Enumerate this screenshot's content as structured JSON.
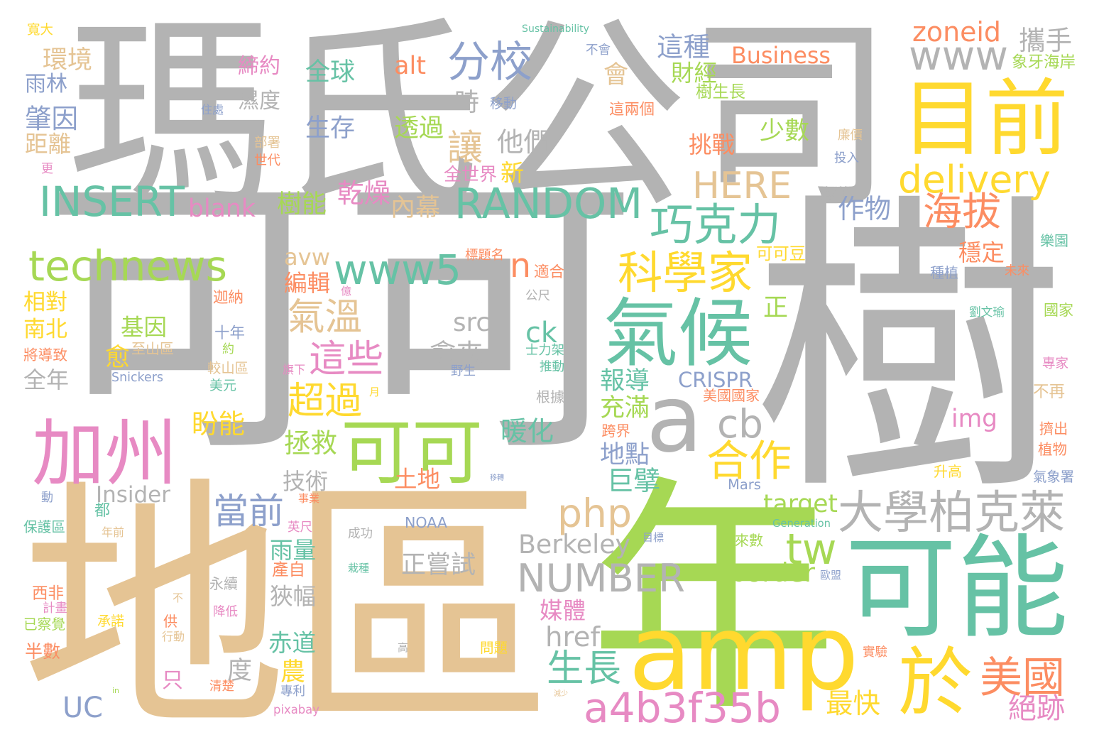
{
  "palette": {
    "gray": "#b3b3b3",
    "tan": "#e5c494",
    "green": "#a6d854",
    "yellow": "#ffd92f",
    "teal": "#66c2a5",
    "orange": "#fc8d62",
    "blue": "#8da0cb",
    "pink": "#e78ac3"
  },
  "words": [
    {
      "text": "瑪氏公司",
      "color": "#b3b3b3"
    },
    {
      "text": "可可",
      "color": "#b3b3b3"
    },
    {
      "text": "樹",
      "color": "#b3b3b3"
    },
    {
      "text": "地區",
      "color": "#e5c494"
    },
    {
      "text": "年",
      "color": "#a6d854"
    },
    {
      "text": "amp",
      "color": "#ffd92f"
    },
    {
      "text": "可能",
      "color": "#66c2a5"
    },
    {
      "text": "目前",
      "color": "#ffd92f"
    },
    {
      "text": "氣候",
      "color": "#66c2a5"
    },
    {
      "text": "加州",
      "color": "#e78ac3"
    },
    {
      "text": "a",
      "color": "#b3b3b3"
    },
    {
      "text": "大學柏克萊",
      "color": "#b3b3b3"
    },
    {
      "text": "於",
      "color": "#ffd92f"
    },
    {
      "text": "美國",
      "color": "#fc8d62"
    },
    {
      "text": "delivery",
      "color": "#ffd92f"
    },
    {
      "text": "海拔",
      "color": "#fc8d62"
    },
    {
      "text": "巧克力",
      "color": "#66c2a5"
    },
    {
      "text": "科學家",
      "color": "#ffd92f"
    },
    {
      "text": "RANDOM",
      "color": "#66c2a5"
    },
    {
      "text": "INSERT",
      "color": "#66c2a5"
    },
    {
      "text": "blank",
      "color": "#e78ac3"
    },
    {
      "text": "technews",
      "color": "#a6d854"
    },
    {
      "text": "www5",
      "color": "#66c2a5"
    },
    {
      "text": "n",
      "color": "#fc8d62"
    },
    {
      "text": "分校",
      "color": "#8da0cb"
    },
    {
      "text": "www",
      "color": "#b3b3b3"
    },
    {
      "text": "zoneid",
      "color": "#fc8d62"
    },
    {
      "text": "攜手",
      "color": "#b3b3b3"
    },
    {
      "text": "Business",
      "color": "#fc8d62"
    },
    {
      "text": "這種",
      "color": "#8da0cb"
    },
    {
      "text": "財經",
      "color": "#a6d854"
    },
    {
      "text": "會",
      "color": "#e5c494"
    },
    {
      "text": "樹生長",
      "color": "#a6d854"
    },
    {
      "text": "象牙海岸",
      "color": "#a6d854"
    },
    {
      "text": "alt",
      "color": "#fc8d62"
    },
    {
      "text": "全球",
      "color": "#66c2a5"
    },
    {
      "text": "締約",
      "color": "#e78ac3"
    },
    {
      "text": "環境",
      "color": "#e5c494"
    },
    {
      "text": "雨林",
      "color": "#8da0cb"
    },
    {
      "text": "濕度",
      "color": "#b3b3b3"
    },
    {
      "text": "肇因",
      "color": "#8da0cb"
    },
    {
      "text": "距離",
      "color": "#e5c494"
    },
    {
      "text": "生存",
      "color": "#8da0cb"
    },
    {
      "text": "時",
      "color": "#b3b3b3"
    },
    {
      "text": "移動",
      "color": "#8da0cb"
    },
    {
      "text": "透過",
      "color": "#a6d854"
    },
    {
      "text": "讓",
      "color": "#e5c494"
    },
    {
      "text": "他們",
      "color": "#b3b3b3"
    },
    {
      "text": "新",
      "color": "#ffd92f"
    },
    {
      "text": "全世界",
      "color": "#e78ac3"
    },
    {
      "text": "乾燥",
      "color": "#e78ac3"
    },
    {
      "text": "內幕",
      "color": "#e5c494"
    },
    {
      "text": "樹能",
      "color": "#a6d854"
    },
    {
      "text": "HERE",
      "color": "#e5c494"
    },
    {
      "text": "挑戰",
      "color": "#fc8d62"
    },
    {
      "text": "少數",
      "color": "#a6d854"
    },
    {
      "text": "這兩個",
      "color": "#fc8d62"
    },
    {
      "text": "作物",
      "color": "#8da0cb"
    },
    {
      "text": "投入",
      "color": "#8da0cb"
    },
    {
      "text": "海洋",
      "color": "#b3b3b3"
    },
    {
      "text": "廉價",
      "color": "#e5c494"
    },
    {
      "text": "可可豆",
      "color": "#ffd92f"
    },
    {
      "text": "穩定",
      "color": "#fc8d62"
    },
    {
      "text": "種植",
      "color": "#8da0cb"
    },
    {
      "text": "劉文瑜",
      "color": "#66c2a5"
    },
    {
      "text": "國家",
      "color": "#a6d854"
    },
    {
      "text": "樂園",
      "color": "#66c2a5"
    },
    {
      "text": "專家",
      "color": "#e78ac3"
    },
    {
      "text": "不再",
      "color": "#e5c494"
    },
    {
      "text": "img",
      "color": "#e78ac3"
    },
    {
      "text": "擠出",
      "color": "#fc8d62"
    },
    {
      "text": "植物",
      "color": "#fc8d62"
    },
    {
      "text": "氣象署",
      "color": "#8da0cb"
    },
    {
      "text": "升高",
      "color": "#ffd92f"
    },
    {
      "text": "未來",
      "color": "#fc8d62"
    },
    {
      "text": "正",
      "color": "#a6d854"
    },
    {
      "text": "CRISPR",
      "color": "#8da0cb"
    },
    {
      "text": "美國國家",
      "color": "#fc8d62"
    },
    {
      "text": "報導",
      "color": "#66c2a5"
    },
    {
      "text": "充滿",
      "color": "#a6d854"
    },
    {
      "text": "跨界",
      "color": "#fc8d62"
    },
    {
      "text": "地點",
      "color": "#8da0cb"
    },
    {
      "text": "巨擘",
      "color": "#66c2a5"
    },
    {
      "text": "Mars",
      "color": "#8da0cb"
    },
    {
      "text": "cb",
      "color": "#b3b3b3"
    },
    {
      "text": "合作",
      "color": "#ffd92f"
    },
    {
      "text": "暖化",
      "color": "#66c2a5"
    },
    {
      "text": "ck",
      "color": "#66c2a5"
    },
    {
      "text": "士力架",
      "color": "#66c2a5"
    },
    {
      "text": "推動",
      "color": "#66c2a5"
    },
    {
      "text": "根據",
      "color": "#b3b3b3"
    },
    {
      "text": "公尺",
      "color": "#b3b3b3"
    },
    {
      "text": "適合",
      "color": "#fc8d62"
    },
    {
      "text": "標題名",
      "color": "#fc8d62"
    },
    {
      "text": "avw",
      "color": "#e5c494"
    },
    {
      "text": "編輯",
      "color": "#fc8d62"
    },
    {
      "text": "氣溫",
      "color": "#e5c494"
    },
    {
      "text": "這些",
      "color": "#e78ac3"
    },
    {
      "text": "超過",
      "color": "#ffd92f"
    },
    {
      "text": "拯救",
      "color": "#a6d854"
    },
    {
      "text": "技術",
      "color": "#b3b3b3"
    },
    {
      "text": "可可",
      "color": "#a6d854"
    },
    {
      "text": "土地",
      "color": "#fc8d62"
    },
    {
      "text": "移轉",
      "color": "#8da0cb"
    },
    {
      "text": "src",
      "color": "#b3b3b3"
    },
    {
      "text": "愈來",
      "color": "#b3b3b3"
    },
    {
      "text": "野生",
      "color": "#8da0cb"
    },
    {
      "text": "月",
      "color": "#ffd92f"
    },
    {
      "text": "億",
      "color": "#e78ac3"
    },
    {
      "text": "旗下",
      "color": "#e78ac3"
    },
    {
      "text": "php",
      "color": "#e5c494"
    },
    {
      "text": "target",
      "color": "#a6d854"
    },
    {
      "text": "Generation",
      "color": "#66c2a5"
    },
    {
      "text": "tw",
      "color": "#a6d854"
    },
    {
      "text": "未來數",
      "color": "#a6d854"
    },
    {
      "text": "目標",
      "color": "#8da0cb"
    },
    {
      "text": "Berkeley",
      "color": "#b3b3b3"
    },
    {
      "text": "NUMBER",
      "color": "#b3b3b3"
    },
    {
      "text": "border",
      "color": "#a6d854"
    },
    {
      "text": "歐盟",
      "color": "#8da0cb"
    },
    {
      "text": "媒體",
      "color": "#e78ac3"
    },
    {
      "text": "href",
      "color": "#b3b3b3"
    },
    {
      "text": "生長",
      "color": "#66c2a5"
    },
    {
      "text": "a4b3f35b",
      "color": "#e78ac3"
    },
    {
      "text": "減少",
      "color": "#e5c494"
    },
    {
      "text": "最快",
      "color": "#ffd92f"
    },
    {
      "text": "絕跡",
      "color": "#e78ac3"
    },
    {
      "text": "實驗",
      "color": "#fc8d62"
    },
    {
      "text": "正嘗試",
      "color": "#b3b3b3"
    },
    {
      "text": "NOAA",
      "color": "#8da0cb"
    },
    {
      "text": "成功",
      "color": "#b3b3b3"
    },
    {
      "text": "栽種",
      "color": "#66c2a5"
    },
    {
      "text": "高",
      "color": "#b3b3b3"
    },
    {
      "text": "問題",
      "color": "#ffd92f"
    },
    {
      "text": "當前",
      "color": "#8da0cb"
    },
    {
      "text": "Insider",
      "color": "#b3b3b3"
    },
    {
      "text": "動",
      "color": "#8da0cb"
    },
    {
      "text": "都",
      "color": "#66c2a5"
    },
    {
      "text": "保護區",
      "color": "#66c2a5"
    },
    {
      "text": "年前",
      "color": "#e5c494"
    },
    {
      "text": "英尺",
      "color": "#e78ac3"
    },
    {
      "text": "事業",
      "color": "#fc8d62"
    },
    {
      "text": "雨量",
      "color": "#66c2a5"
    },
    {
      "text": "產自",
      "color": "#fc8d62"
    },
    {
      "text": "狹幅",
      "color": "#b3b3b3"
    },
    {
      "text": "赤道",
      "color": "#66c2a5"
    },
    {
      "text": "農",
      "color": "#ffd92f"
    },
    {
      "text": "度",
      "color": "#b3b3b3"
    },
    {
      "text": "只",
      "color": "#e78ac3"
    },
    {
      "text": "永續",
      "color": "#b3b3b3"
    },
    {
      "text": "不",
      "color": "#e5c494"
    },
    {
      "text": "供",
      "color": "#fc8d62"
    },
    {
      "text": "行動",
      "color": "#e5c494"
    },
    {
      "text": "承諾",
      "color": "#ffd92f"
    },
    {
      "text": "降低",
      "color": "#e78ac3"
    },
    {
      "text": "西非",
      "color": "#fc8d62"
    },
    {
      "text": "計畫",
      "color": "#e78ac3"
    },
    {
      "text": "已察覺",
      "color": "#a6d854"
    },
    {
      "text": "半數",
      "color": "#fc8d62"
    },
    {
      "text": "UC",
      "color": "#8da0cb"
    },
    {
      "text": "in",
      "color": "#a6d854"
    },
    {
      "text": "清楚",
      "color": "#fc8d62"
    },
    {
      "text": "專利",
      "color": "#8da0cb"
    },
    {
      "text": "pixabay",
      "color": "#e78ac3"
    },
    {
      "text": "相對",
      "color": "#ffd92f"
    },
    {
      "text": "南北",
      "color": "#ffd92f"
    },
    {
      "text": "將導致",
      "color": "#fc8d62"
    },
    {
      "text": "全年",
      "color": "#b3b3b3"
    },
    {
      "text": "基因",
      "color": "#a6d854"
    },
    {
      "text": "愈",
      "color": "#ffd92f"
    },
    {
      "text": "至山區",
      "color": "#e5c494"
    },
    {
      "text": "Snickers",
      "color": "#8da0cb"
    },
    {
      "text": "迦納",
      "color": "#fc8d62"
    },
    {
      "text": "十年",
      "color": "#8da0cb"
    },
    {
      "text": "約",
      "color": "#a6d854"
    },
    {
      "text": "較山區",
      "color": "#e5c494"
    },
    {
      "text": "美元",
      "color": "#66c2a5"
    },
    {
      "text": "盼能",
      "color": "#ffd92f"
    },
    {
      "text": "寬大",
      "color": "#ffd92f"
    },
    {
      "text": "Sustainability",
      "color": "#66c2a5"
    },
    {
      "text": "不會",
      "color": "#8da0cb"
    },
    {
      "text": "住處",
      "color": "#8da0cb"
    },
    {
      "text": "部署",
      "color": "#e5c494"
    },
    {
      "text": "世代",
      "color": "#fc8d62"
    },
    {
      "text": "更",
      "color": "#e78ac3"
    }
  ]
}
